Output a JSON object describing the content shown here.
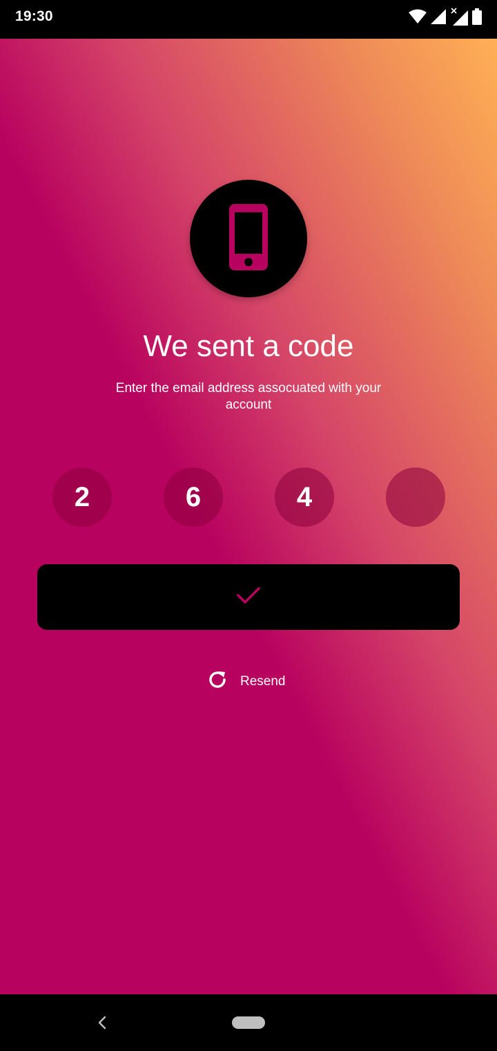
{
  "status_bar": {
    "time": "19:30",
    "icons": [
      "wifi-icon",
      "signal-icon",
      "signal-no-data-icon",
      "battery-icon"
    ]
  },
  "header": {
    "icon": "smartphone-icon",
    "title": "We sent a code",
    "subtitle": "Enter the email address assocuated with your account"
  },
  "code": {
    "digits": [
      "2",
      "6",
      "4",
      ""
    ]
  },
  "confirm_button": {
    "icon": "checkmark-icon"
  },
  "resend": {
    "icon": "refresh-icon",
    "label": "Resend"
  },
  "colors": {
    "background": "#b8025f",
    "gradient_top": "#ffb055",
    "accent": "#b8025f",
    "button": "#000000",
    "text": "#ffffff"
  },
  "nav_bar": {
    "icons": [
      "back-icon",
      "home-pill-icon"
    ]
  }
}
